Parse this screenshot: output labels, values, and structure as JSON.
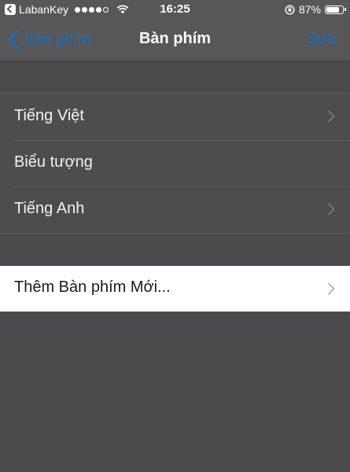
{
  "status_bar": {
    "app_name": "LabanKey",
    "time": "16:25",
    "battery_percent": "87%",
    "signal_bars_filled": 4,
    "signal_bars_total": 5
  },
  "nav": {
    "back_label": "Bàn phím",
    "title": "Bàn phím",
    "edit_label": "Sửa"
  },
  "keyboards": [
    {
      "label": "Tiếng Việt",
      "has_chevron": true
    },
    {
      "label": "Biểu tượng",
      "has_chevron": false
    },
    {
      "label": "Tiếng Anh",
      "has_chevron": true
    }
  ],
  "add_keyboard": {
    "label": "Thêm Bàn phím Mới..."
  },
  "colors": {
    "accent": "#1a6fb8",
    "background": "#4a4a4c"
  }
}
